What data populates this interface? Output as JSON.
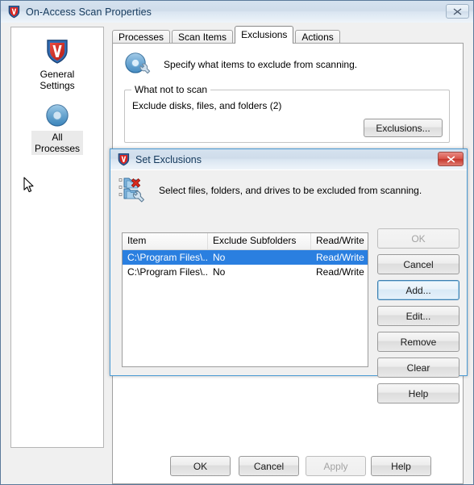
{
  "window": {
    "title": "On-Access Scan Properties",
    "icon": "vshield-icon",
    "close_label": "✕"
  },
  "sidebar": {
    "items": [
      {
        "label": "General\nSettings",
        "label_line1": "General",
        "label_line2": "Settings",
        "icon": "shield-icon",
        "selected": false
      },
      {
        "label": "All\nProcesses",
        "label_line1": "All",
        "label_line2": "Processes",
        "icon": "blue-circle-icon",
        "selected": true
      }
    ]
  },
  "tabs": [
    {
      "label": "Processes",
      "active": false
    },
    {
      "label": "Scan Items",
      "active": false
    },
    {
      "label": "Exclusions",
      "active": true
    },
    {
      "label": "Actions",
      "active": false
    }
  ],
  "page": {
    "icon": "disk-wrench-icon",
    "description": "Specify what items to exclude from scanning.",
    "groupbox": {
      "title": "What not to scan",
      "line": "Exclude disks, files, and folders (2)",
      "button": "Exclusions..."
    }
  },
  "footer": {
    "ok": "OK",
    "cancel": "Cancel",
    "apply": "Apply",
    "help": "Help"
  },
  "dialog": {
    "title": "Set Exclusions",
    "icon": "folder-exclude-wrench-icon",
    "close_label": "✕",
    "description": "Select files, folders, and drives to be excluded from scanning.",
    "list": {
      "columns": [
        "Item",
        "Exclude Subfolders",
        "Read/Write"
      ],
      "rows": [
        {
          "item": "C:\\Program Files\\...",
          "exclude_subfolders": "No",
          "read_write": "Read/Write",
          "selected": true
        },
        {
          "item": "C:\\Program Files\\...",
          "exclude_subfolders": "No",
          "read_write": "Read/Write",
          "selected": false
        }
      ]
    },
    "buttons": [
      {
        "label": "OK",
        "state": "disabled"
      },
      {
        "label": "Cancel",
        "state": "normal"
      },
      {
        "label": "Add...",
        "state": "focused"
      },
      {
        "label": "Edit...",
        "state": "normal"
      },
      {
        "label": "Remove",
        "state": "normal"
      },
      {
        "label": "Clear",
        "state": "normal"
      },
      {
        "label": "Help",
        "state": "normal"
      }
    ]
  },
  "colors": {
    "selection_blue": "#2a7fe0",
    "title_text": "#14395c",
    "dialog_border": "#4a9ad4",
    "close_red": "#c4352b",
    "face": "#f0f0f0"
  }
}
